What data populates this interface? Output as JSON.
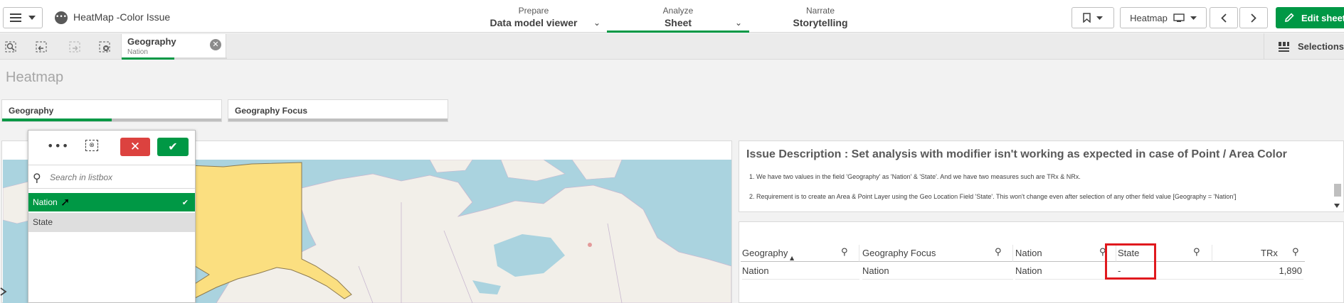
{
  "topbar": {
    "app_title": "HeatMap -Color Issue",
    "nav": [
      {
        "small": "Prepare",
        "big": "Data model viewer"
      },
      {
        "small": "Analyze",
        "big": "Sheet"
      },
      {
        "small": "Narrate",
        "big": "Storytelling"
      }
    ],
    "sheet_name": "Heatmap",
    "edit_label": "Edit sheet",
    "accent": "#009845"
  },
  "selection_bar": {
    "chip": {
      "field": "Geography",
      "value": "Nation"
    },
    "selections_label": "Selections"
  },
  "sheet": {
    "title": "Heatmap",
    "filters": [
      {
        "label": "Geography",
        "selected_fraction": 0.5
      },
      {
        "label": "Geography Focus",
        "selected_fraction": 0
      }
    ]
  },
  "listbox": {
    "more": "•••",
    "search_placeholder": "Search in listbox",
    "items": [
      {
        "label": "Nation",
        "state": "selected"
      },
      {
        "label": "State",
        "state": "alternative"
      }
    ],
    "colors": {
      "selected": "#009845",
      "alternative": "#dedede",
      "cancel": "#dc423f"
    }
  },
  "issue": {
    "title": "Issue Description : Set analysis with modifier isn't working as expected in case of Point / Area Color",
    "lines": [
      "1. We have two values in the field 'Geography' as 'Nation' & 'State'. And we have two measures such are TRx & NRx.",
      "2. Requirement is to create an Area & Point Layer using the Geo Location Field 'State'. This won't change even after selection of any other field value [Geography = 'Nation']"
    ]
  },
  "table": {
    "headers": [
      "Geography",
      "Geography Focus",
      "Nation",
      "State",
      "TRx"
    ],
    "rows": [
      [
        "Nation",
        "Nation",
        "Nation",
        "-",
        "1,890"
      ]
    ],
    "highlight_color": "#e0191e"
  },
  "map": {
    "land": "#f2efe9",
    "water": "#aad3df",
    "highlight_area": "#fbdf80"
  }
}
